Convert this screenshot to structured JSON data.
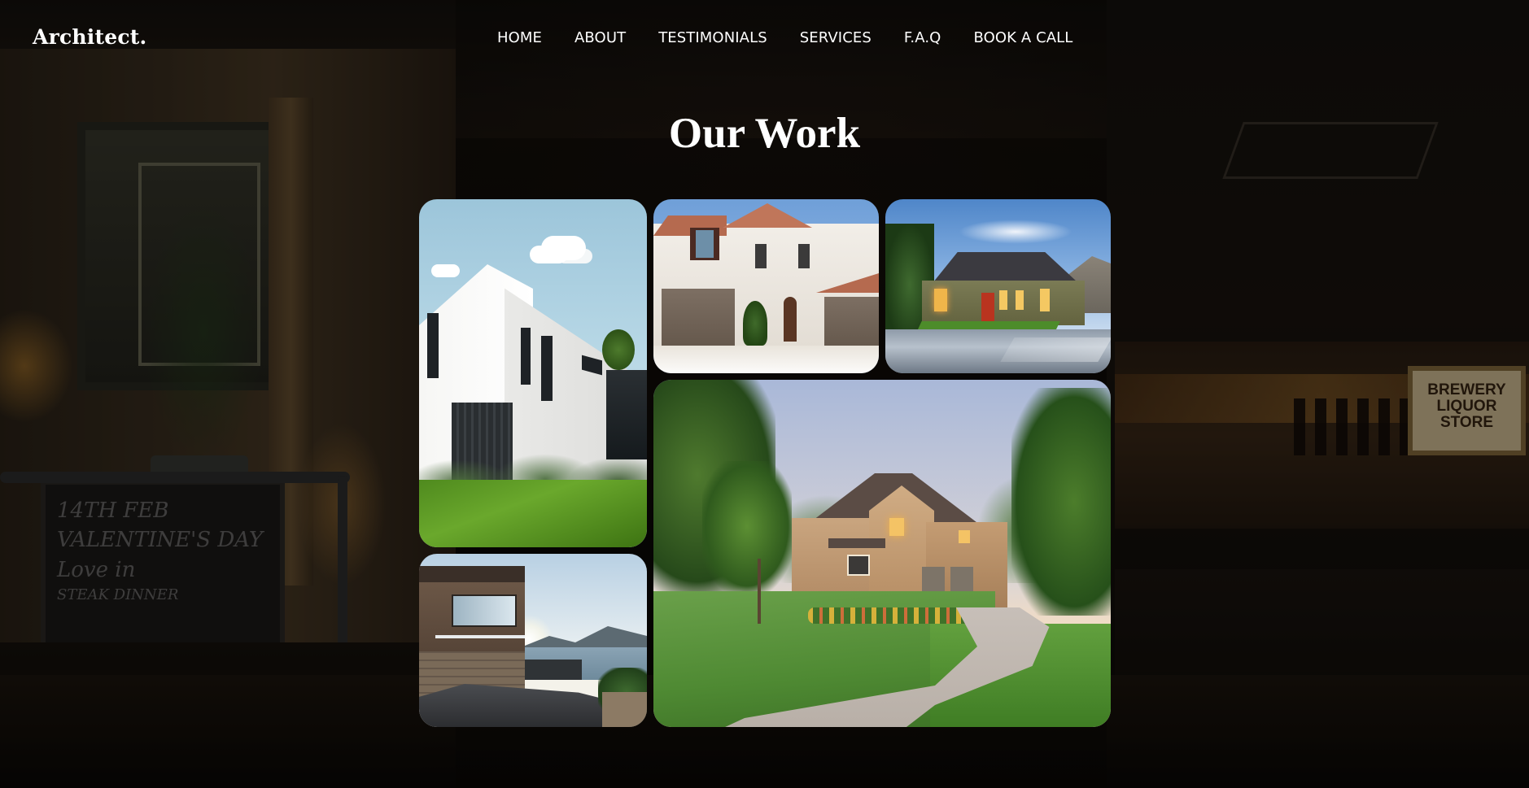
{
  "header": {
    "logo": "Architect.",
    "nav": [
      "HOME",
      "ABOUT",
      "TESTIMONIALS",
      "SERVICES",
      "F.A.Q",
      "BOOK A CALL"
    ]
  },
  "section": {
    "title": "Our Work"
  },
  "background": {
    "board_text": [
      "14TH FEB",
      "VALENTINE'S DAY",
      "Love in",
      "STEAK DINNER"
    ],
    "sign_text": [
      "BREWERY",
      "LIQUOR",
      "STORE"
    ]
  },
  "gallery": {
    "images": [
      {
        "name": "white-modern-house-photo"
      },
      {
        "name": "mediterranean-villa-photo"
      },
      {
        "name": "green-house-dusk-photo"
      },
      {
        "name": "stone-craftsman-house-photo"
      },
      {
        "name": "lakeside-cliff-house-photo"
      }
    ]
  },
  "colors": {
    "text": "#ffffff",
    "overlay": "#000000"
  }
}
